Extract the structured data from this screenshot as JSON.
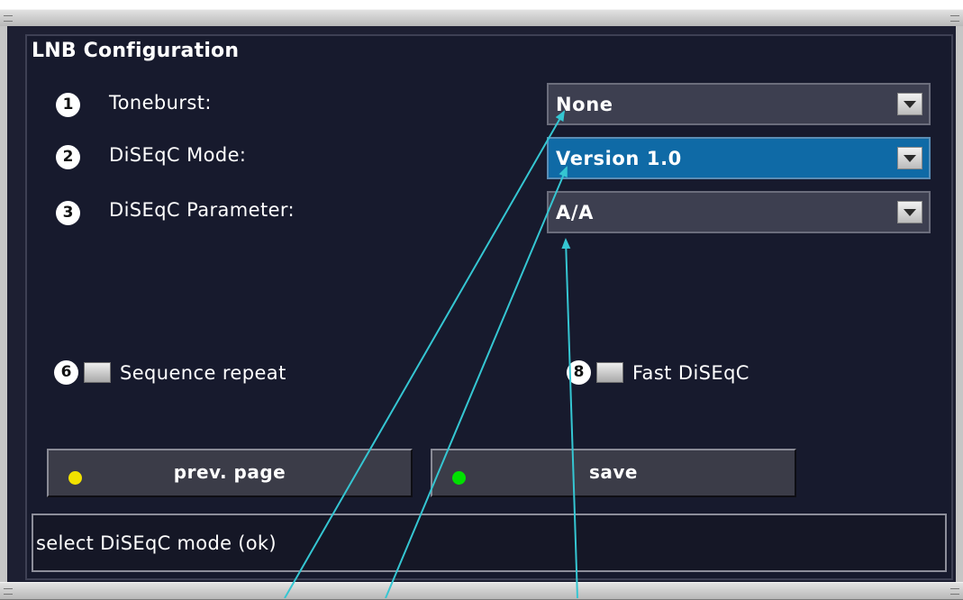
{
  "window": {
    "title": "LNB Configuration"
  },
  "fields": [
    {
      "number": "1",
      "label": "Toneburst:",
      "value": "None"
    },
    {
      "number": "2",
      "label": "DiSEqC Mode:",
      "value": "Version 1.0"
    },
    {
      "number": "3",
      "label": "DiSEqC Parameter:",
      "value": "A/A"
    }
  ],
  "checkboxes": [
    {
      "number": "6",
      "label": "Sequence repeat",
      "checked": false
    },
    {
      "number": "8",
      "label": "Fast DiSEqC",
      "checked": false
    }
  ],
  "buttons": {
    "prev_label": "prev. page",
    "prev_dot_color": "#f2e200",
    "save_label": "save",
    "save_dot_color": "#00e000"
  },
  "status": {
    "text": "select DiSEqC mode (ok)"
  },
  "colors": {
    "selection": "#0f6aa6",
    "annotation_arrow": "#35c6d2"
  }
}
